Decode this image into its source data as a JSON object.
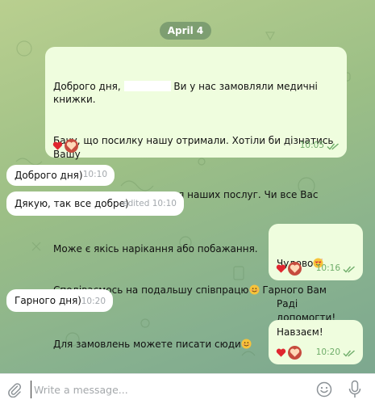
{
  "date_separator": "April 4",
  "messages": [
    {
      "direction": "outgoing",
      "lines": [
        {
          "before": "Доброго дня, ",
          "redacted": true,
          "after": " Ви у нас замовляли медичні книжки."
        },
        {
          "text": "Бачу, що посилку нашу отримали. Хотіли би дізнатись Вашу"
        },
        {
          "text": "думку задля покращення наших послуг. Чи все Вас влаштувало?"
        },
        {
          "text": "Може є якісь нарікання або побажання."
        },
        {
          "before": "Сподіваємось на подальшу співпрацю",
          "emoji": "smile-emoji",
          "after": " Гарного Вам дня",
          "emoji2": "wave-emoji"
        },
        {
          "before": "Для замовлень можете писати сюди",
          "emoji": "smile-emoji"
        }
      ],
      "reactions": [
        "red-heart",
        "heart-reaction"
      ],
      "time": "10:05",
      "status": "read-double-check"
    },
    {
      "direction": "incoming",
      "text": "Доброго дня)",
      "time": "10:10"
    },
    {
      "direction": "incoming",
      "text": "Дякую, так все добре)",
      "time": "edited 10:10"
    },
    {
      "direction": "outgoing",
      "line1": "Чудово",
      "line1_emoji": "hearts-face-emoji",
      "line2": "Раді допомогти!",
      "reactions": [
        "red-heart",
        "heart-reaction"
      ],
      "time": "10:16",
      "status": "read-double-check"
    },
    {
      "direction": "incoming",
      "text": "Гарного дня)",
      "time": "10:20"
    },
    {
      "direction": "outgoing",
      "text": "Навзаєм!",
      "reactions": [
        "red-heart",
        "heart-reaction"
      ],
      "time": "10:20",
      "status": "read-double-check"
    }
  ],
  "composer": {
    "placeholder": "Write a message...",
    "value": "",
    "attach_icon": "paperclip-icon",
    "emoji_icon": "smile-icon",
    "mic_icon": "microphone-icon"
  },
  "colors": {
    "outgoing_bubble": "#effdde",
    "incoming_bubble": "#ffffff",
    "read_check": "#6fad6a",
    "date_pill": "#587c5c"
  }
}
